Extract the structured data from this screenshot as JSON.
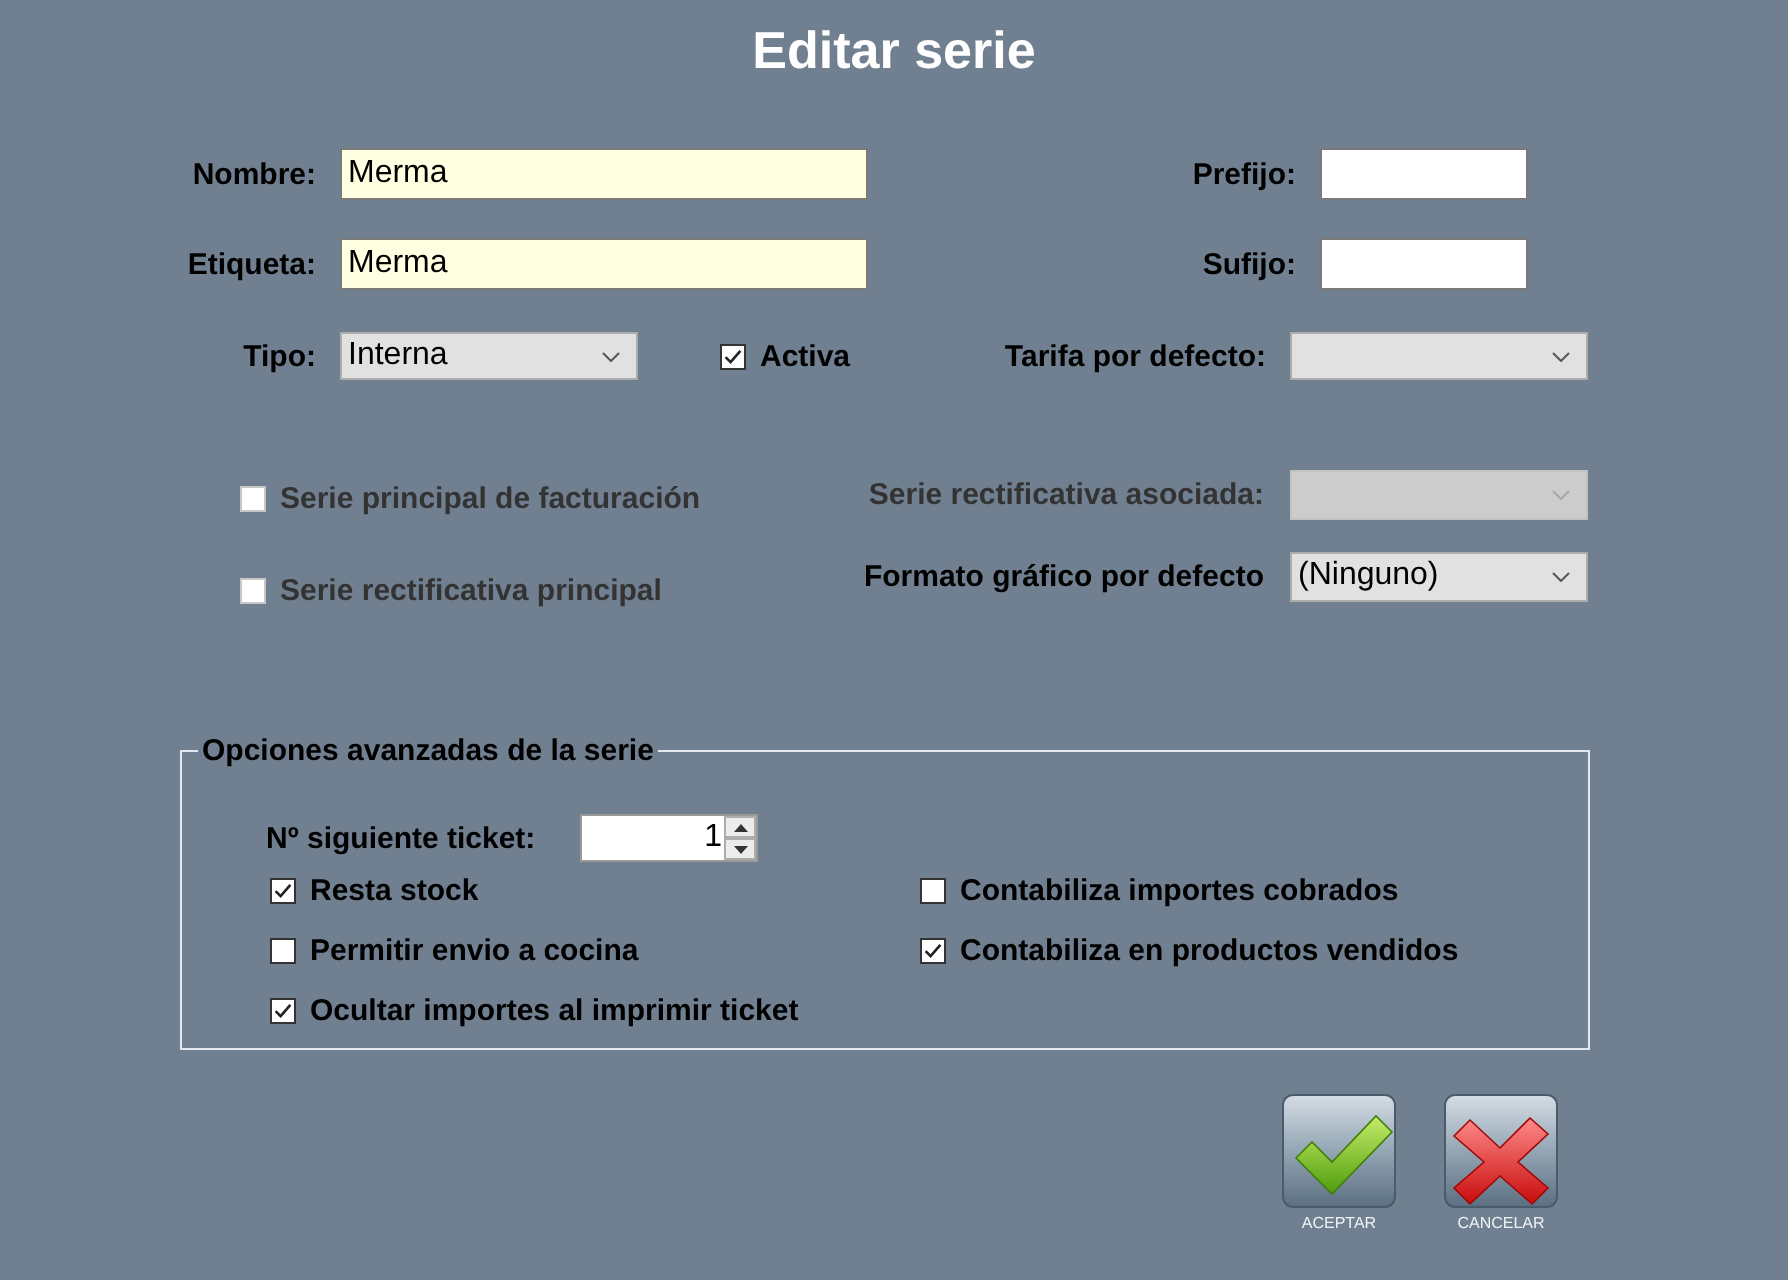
{
  "window": {
    "title": "Editar serie"
  },
  "text_fields": [
    {
      "label": "Nombre:",
      "value": "Merma"
    },
    {
      "label": "Etiqueta:",
      "value": "Merma"
    }
  ],
  "affix_fields": [
    {
      "label": "Prefijo:"
    },
    {
      "label": "Sufijo:"
    }
  ],
  "tipo": {
    "label": "Tipo:",
    "value": "Interna"
  },
  "activa": {
    "label": "Activa",
    "checked": true
  },
  "tarifa": {
    "label": "Tarifa por defecto:"
  },
  "series_options": [
    {
      "label": "Serie principal de facturación",
      "checked": false,
      "disabled": true
    },
    {
      "label": "Serie rectificativa principal",
      "checked": false,
      "disabled": true
    }
  ],
  "series_selects": [
    {
      "label": "Serie rectificativa asociada:",
      "disabled": true
    },
    {
      "label": "Formato gráfico por defecto",
      "value": "(Ninguno)",
      "disabled": false
    }
  ],
  "advanced": {
    "title": "Opciones avanzadas de la serie",
    "next_ticket": {
      "label": "Nº siguiente ticket:",
      "value": "1"
    },
    "options": [
      {
        "label": "Resta stock",
        "checked": true
      },
      {
        "label": "Contabiliza importes cobrados",
        "checked": false
      },
      {
        "label": "Permitir envio a cocina",
        "checked": false
      },
      {
        "label": "Contabiliza en productos vendidos",
        "checked": true
      },
      {
        "label": "Ocultar importes al imprimir ticket",
        "checked": true
      }
    ]
  },
  "buttons": [
    {
      "kind": "accept",
      "label": "ACEPTAR"
    },
    {
      "kind": "cancel",
      "label": "CANCELAR"
    }
  ]
}
